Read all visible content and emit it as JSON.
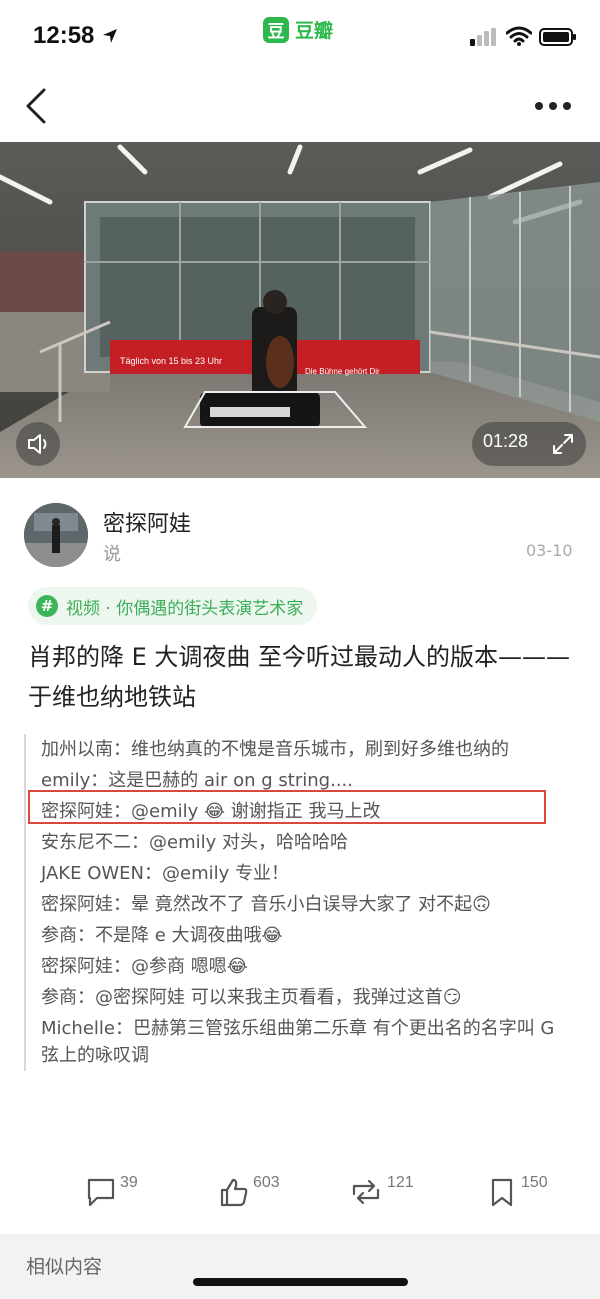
{
  "status_bar": {
    "time": "12:58"
  },
  "app": {
    "icon_text": "豆",
    "name": "豆瓣",
    "brand_color": "#2db84d"
  },
  "video": {
    "duration": "01:28",
    "banner_text": "Täglich von 15 bis 23 Uhr",
    "banner_right": "Die Bühne gehört Dir"
  },
  "post": {
    "author": "密探阿娃",
    "kind": "说",
    "date": "03-10",
    "topic": "视频 · 你偶遇的街头表演艺术家",
    "title": "肖邦的降 E 大调夜曲 至今听过最动人的版本———于维也纳地铁站"
  },
  "comments": [
    "加州以南：维也纳真的不愧是音乐城市，刷到好多维也纳的",
    "emily：这是巴赫的 air on g string....",
    "密探阿娃：@emily 😂 谢谢指正 我马上改",
    "安东尼不二：@emily 对头，哈哈哈哈",
    "JAKE OWEN：@emily 专业！",
    "密探阿娃：晕 竟然改不了 音乐小白误导大家了 对不起🙃",
    "参商：不是降 e 大调夜曲哦😂",
    "密探阿娃：@参商 嗯嗯😂",
    "参商：@密探阿娃 可以来我主页看看，我弹过这首😏",
    "Michelle：巴赫第三管弦乐组曲第二乐章 有个更出名的名字叫 G 弦上的咏叹调"
  ],
  "actions": {
    "comments": "39",
    "likes": "603",
    "reshares": "121",
    "collects": "150"
  },
  "footer": {
    "similar": "相似内容"
  }
}
